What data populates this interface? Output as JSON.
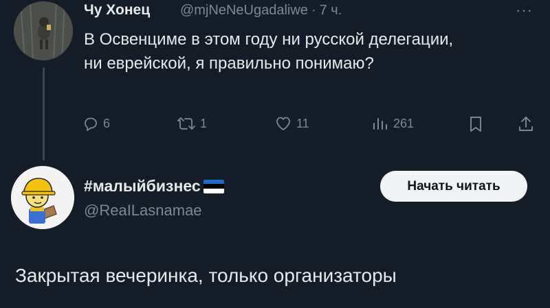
{
  "reply_to": {
    "author_name": "Чу Хонец",
    "handle": "@mjNeNeUgadaliwe",
    "separator": "·",
    "time": "7 ч.",
    "more_label": "···",
    "text": "В Освенциме в этом году ни русской делегации, ни еврейской, я правильно понимаю?",
    "actions": {
      "replies": "6",
      "reposts": "1",
      "likes": "11",
      "views": "261"
    },
    "icons": {
      "reply": "reply-icon",
      "repost": "repost-icon",
      "like": "heart-icon",
      "views": "views-icon",
      "bookmark": "bookmark-icon",
      "share": "share-icon"
    }
  },
  "tweet": {
    "author_name": "#малыйбизнес",
    "flag": [
      "#1f6cc4",
      "#000000",
      "#ffffff"
    ],
    "handle": "@ReaILasnamae",
    "follow_label": "Начать читать",
    "text": "Закрытая вечеринка, только организаторы"
  },
  "colors": {
    "background": "#151d28",
    "text": "#e7e9ea",
    "muted": "#7d8893",
    "button_bg": "#eff3f4"
  }
}
